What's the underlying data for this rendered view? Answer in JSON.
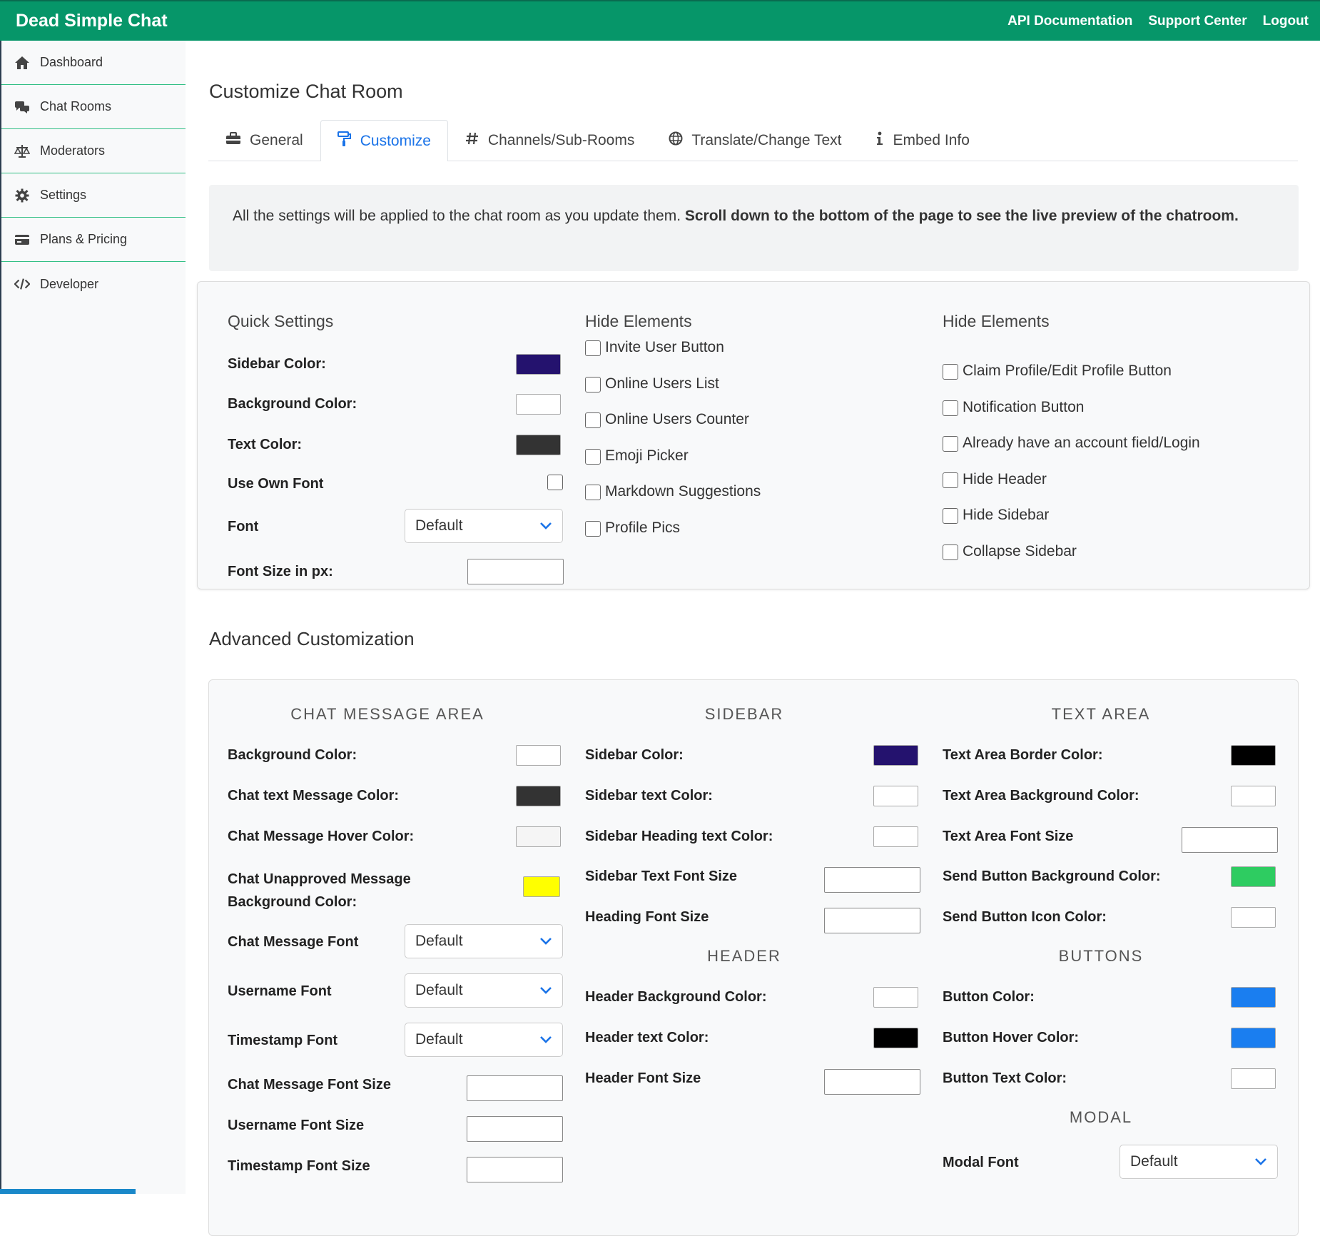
{
  "app": {
    "brand": "Dead Simple Chat"
  },
  "topnav": [
    "API Documentation",
    "Support Center",
    "Logout"
  ],
  "sidebar": {
    "items": [
      {
        "label": "Dashboard",
        "icon": "home-icon"
      },
      {
        "label": "Chat Rooms",
        "icon": "chat-bubbles-icon"
      },
      {
        "label": "Moderators",
        "icon": "scale-icon"
      },
      {
        "label": "Settings",
        "icon": "gear-icon"
      },
      {
        "label": "Plans & Pricing",
        "icon": "credit-card-icon"
      },
      {
        "label": "Developer",
        "icon": "code-icon"
      }
    ]
  },
  "page": {
    "title": "Customize Chat Room"
  },
  "tabs": [
    {
      "label": "General",
      "icon": "toolbox-icon"
    },
    {
      "label": "Customize",
      "icon": "paint-roller-icon"
    },
    {
      "label": "Channels/Sub-Rooms",
      "icon": "hashtag-icon"
    },
    {
      "label": "Translate/Change Text",
      "icon": "globe-icon"
    },
    {
      "label": "Embed Info",
      "icon": "info-icon"
    }
  ],
  "notice": {
    "text": "All the settings will be applied to the chat room as you update them.",
    "bold": "Scroll down to the bottom of the page to see the live preview of the chatroom."
  },
  "quick": {
    "heading": "Quick Settings",
    "sidebar_color_label": "Sidebar Color:",
    "sidebar_color": "#24126e",
    "background_color_label": "Background Color:",
    "background_color": "#ffffff",
    "text_color_label": "Text Color:",
    "text_color": "#333333",
    "use_own_font_label": "Use Own Font",
    "font_label": "Font",
    "font_value": "Default",
    "font_size_label": "Font Size in px:"
  },
  "hide1": {
    "heading": "Hide Elements",
    "items": [
      "Invite User Button",
      "Online Users List",
      "Online Users Counter",
      "Emoji Picker",
      "Markdown Suggestions",
      "Profile Pics"
    ]
  },
  "hide2": {
    "heading": "Hide Elements",
    "items": [
      "Claim Profile/Edit Profile Button",
      "Notification Button",
      "Already have an account field/Login",
      "Hide Header",
      "Hide Sidebar",
      "Collapse Sidebar"
    ]
  },
  "advanced": {
    "title": "Advanced Customization",
    "chat_area": {
      "heading": "CHAT MESSAGE AREA",
      "bg_label": "Background Color:",
      "bg_color": "#ffffff",
      "text_label": "Chat text Message Color:",
      "text_color": "#333333",
      "hover_label": "Chat Message Hover Color:",
      "hover_color": "#f5f5f5",
      "unapproved_label_1": "Chat Unapproved Message",
      "unapproved_label_2": "Background Color:",
      "unapproved_color": "#ffff00",
      "msg_font_label": "Chat Message Font",
      "msg_font_value": "Default",
      "user_font_label": "Username Font",
      "user_font_value": "Default",
      "ts_font_label": "Timestamp Font",
      "ts_font_value": "Default",
      "msg_size_label": "Chat Message Font Size",
      "user_size_label": "Username Font Size",
      "ts_size_label": "Timestamp Font Size"
    },
    "sidebar": {
      "heading": "SIDEBAR",
      "color_label": "Sidebar Color:",
      "color": "#24126e",
      "text_label": "Sidebar text Color:",
      "text_color": "#ffffff",
      "heading_text_label": "Sidebar Heading text Color:",
      "heading_text_color": "#ffffff",
      "font_size_label": "Sidebar Text Font Size",
      "heading_size_label": "Heading Font Size"
    },
    "header": {
      "heading": "HEADER",
      "bg_label": "Header Background Color:",
      "bg_color": "#ffffff",
      "text_label": "Header text Color:",
      "text_color": "#000000",
      "size_label": "Header Font Size"
    },
    "text_area": {
      "heading": "TEXT AREA",
      "border_label": "Text Area Border Color:",
      "border_color": "#000000",
      "bg_label": "Text Area Background Color:",
      "bg_color": "#ffffff",
      "size_label": "Text Area Font Size",
      "send_bg_label": "Send Button Background Color:",
      "send_bg_color": "#2ecc61",
      "send_icon_label": "Send Button Icon Color:",
      "send_icon_color": "#ffffff"
    },
    "buttons": {
      "heading": "BUTTONS",
      "color_label": "Button Color:",
      "color": "#1a7ef0",
      "hover_label": "Button Hover Color:",
      "hover_color": "#1a7ef0",
      "text_label": "Button Text Color:",
      "text_color": "#ffffff"
    },
    "modal": {
      "heading": "MODAL",
      "font_label": "Modal Font",
      "font_value": "Default"
    }
  }
}
